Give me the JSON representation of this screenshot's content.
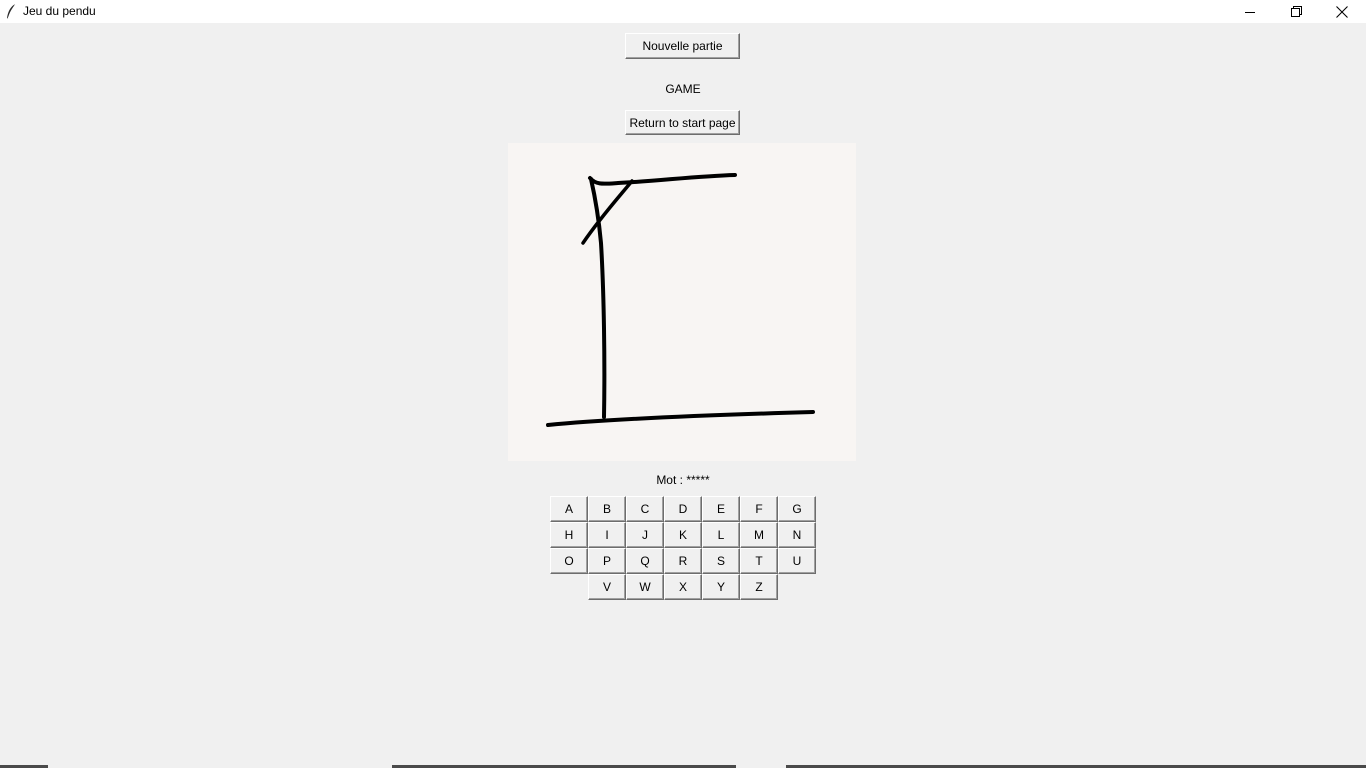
{
  "window": {
    "title": "Jeu du pendu",
    "icon": "feather-icon",
    "controls": [
      "minimize-icon",
      "restore-icon",
      "close-icon"
    ]
  },
  "buttons": {
    "new_game": "Nouvelle partie",
    "return_start": "Return to start page"
  },
  "game_label": "GAME",
  "word": {
    "prefix": "Mot : ",
    "masked": "*****"
  },
  "letters": {
    "row1": [
      "A",
      "B",
      "C",
      "D",
      "E",
      "F",
      "G"
    ],
    "row2": [
      "H",
      "I",
      "J",
      "K",
      "L",
      "M",
      "N"
    ],
    "row3": [
      "O",
      "P",
      "Q",
      "R",
      "S",
      "T",
      "U"
    ],
    "row4": [
      "V",
      "W",
      "X",
      "Y",
      "Z"
    ]
  },
  "colors": {
    "window_bg": "#f0f0f0",
    "canvas_bg": "#f8f5f3",
    "ink": "#000000"
  }
}
